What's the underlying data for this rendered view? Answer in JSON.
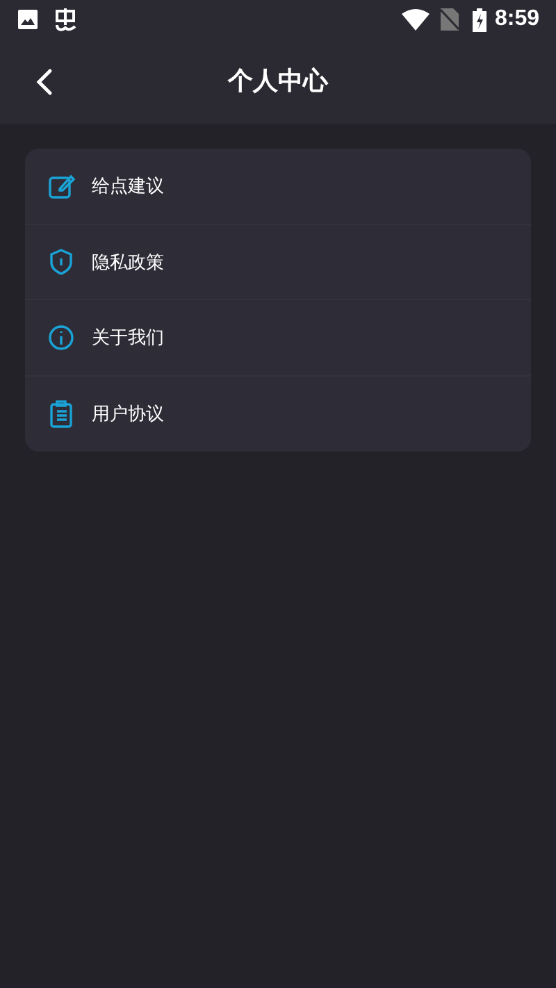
{
  "status_bar": {
    "time": "8:59"
  },
  "header": {
    "title": "个人中心"
  },
  "menu": [
    {
      "kind": "edit",
      "label": "给点建议"
    },
    {
      "kind": "shield",
      "label": "隐私政策"
    },
    {
      "kind": "info",
      "label": "关于我们"
    },
    {
      "kind": "clipboard",
      "label": "用户协议"
    }
  ]
}
